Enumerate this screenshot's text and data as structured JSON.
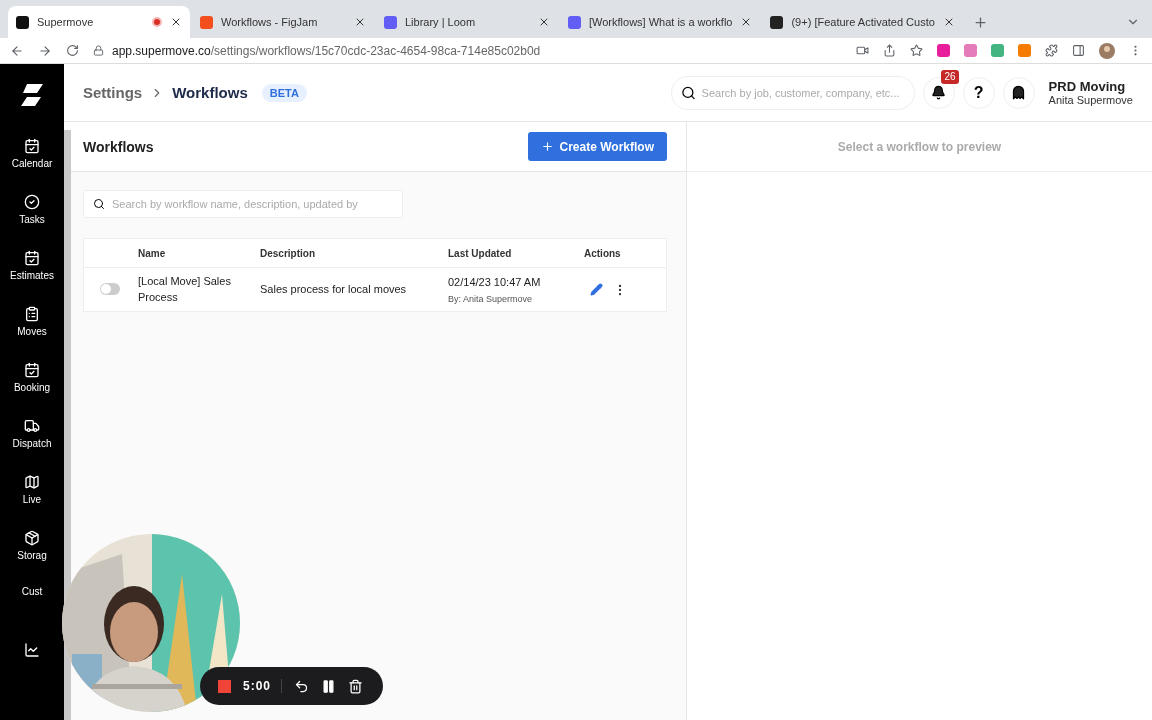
{
  "browser": {
    "tabs": [
      {
        "title": "Supermove",
        "selected": true,
        "recording": true,
        "color": "#111111"
      },
      {
        "title": "Workflows - FigJam",
        "selected": false,
        "recording": false,
        "color": "#f24e1e"
      },
      {
        "title": "Library | Loom",
        "selected": false,
        "recording": false,
        "color": "#625df5"
      },
      {
        "title": "[Workflows] What is a workflo",
        "selected": false,
        "recording": false,
        "color": "#625df5"
      },
      {
        "title": "(9+) [Feature Activated Custo",
        "selected": false,
        "recording": false,
        "color": "#222222"
      }
    ],
    "url_host": "app.supermove.co",
    "url_path": "/settings/workflows/15c70cdc-23ac-4654-98ca-714e85c02b0d"
  },
  "sidebar": {
    "items": [
      {
        "label": "Calendar",
        "kind": "calendar"
      },
      {
        "label": "Tasks",
        "kind": "check"
      },
      {
        "label": "Estimates",
        "kind": "calendar"
      },
      {
        "label": "Moves",
        "kind": "clipboard"
      },
      {
        "label": "Booking",
        "kind": "calendar"
      },
      {
        "label": "Dispatch",
        "kind": "truck"
      },
      {
        "label": "Live",
        "kind": "map"
      },
      {
        "label": "Storag",
        "kind": "box"
      },
      {
        "label": "Cust",
        "kind": "none"
      },
      {
        "kind": "chart"
      }
    ]
  },
  "header": {
    "breadcrumb": [
      "Settings",
      "Workflows"
    ],
    "badge": "BETA",
    "search": {
      "placeholder": "Search by job, customer, company, etc..."
    },
    "notifications": "26",
    "help": "?",
    "org": "PRD Moving",
    "user": "Anita Supermove"
  },
  "workflows": {
    "title": "Workflows",
    "create_button": "Create Workflow",
    "search": {
      "placeholder": "Search by workflow name, description, updated by"
    },
    "table": {
      "columns": [
        "Name",
        "Description",
        "Last Updated",
        "Actions"
      ],
      "rows": [
        {
          "on": false,
          "name": "[Local Move] Sales Process",
          "description": "Sales process for local moves",
          "updated": "02/14/23 10:47 AM",
          "updated_by": "By: Anita Supermove"
        }
      ]
    }
  },
  "preview": {
    "empty_text": "Select a workflow to preview"
  },
  "recorder": {
    "time": "5:00"
  }
}
